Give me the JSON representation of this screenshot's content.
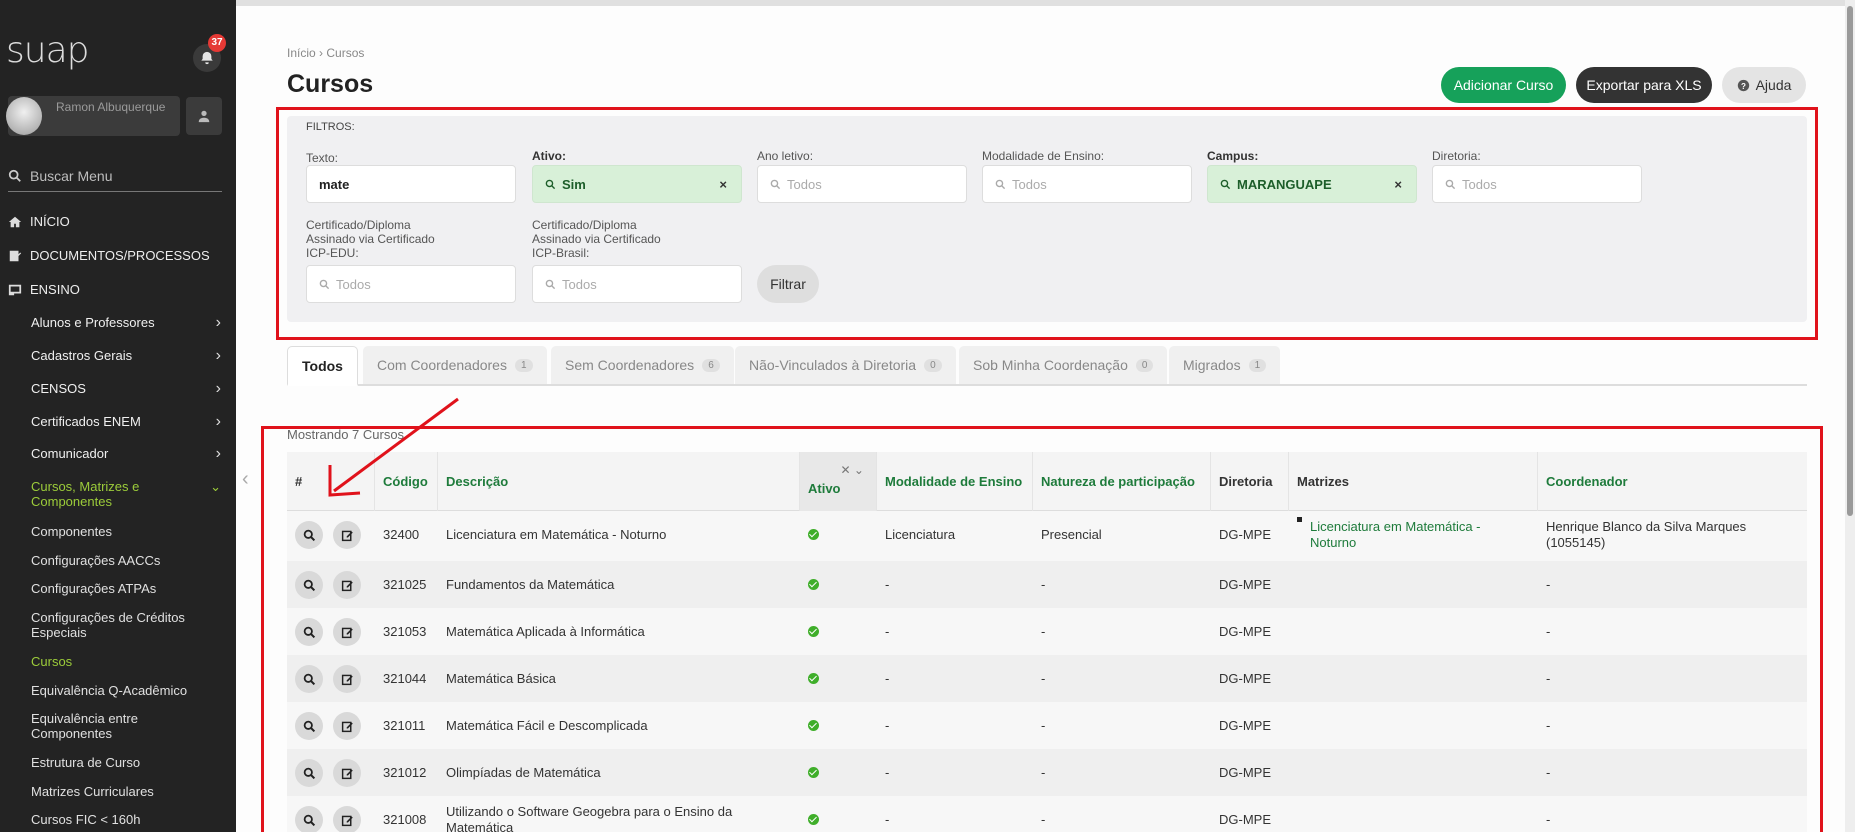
{
  "sidebar": {
    "logo": "suap",
    "notification_count": "37",
    "user_name": "Ramon Albuquerque",
    "search_placeholder": "Buscar Menu",
    "top_items": [
      {
        "label": "INÍCIO",
        "icon": "home-icon"
      },
      {
        "label": "DOCUMENTOS/PROCESSOS",
        "icon": "document-icon"
      },
      {
        "label": "ENSINO",
        "icon": "teaching-icon"
      }
    ],
    "sub_items": [
      {
        "label": "Alunos e Professores"
      },
      {
        "label": "Cadastros Gerais"
      },
      {
        "label": "CENSOS"
      },
      {
        "label": "Certificados ENEM"
      },
      {
        "label": "Comunicador"
      },
      {
        "label": "Cursos, Matrizes e Componentes"
      }
    ],
    "sub_sub_items": [
      {
        "label": "Componentes"
      },
      {
        "label": "Configurações AACCs"
      },
      {
        "label": "Configurações ATPAs"
      },
      {
        "label": "Configurações de Créditos Especiais"
      },
      {
        "label": "Cursos"
      },
      {
        "label": "Equivalência Q-Acadêmico"
      },
      {
        "label": "Equivalência entre Componentes"
      },
      {
        "label": "Estrutura de Curso"
      },
      {
        "label": "Matrizes Curriculares"
      },
      {
        "label": "Cursos FIC < 160h"
      }
    ]
  },
  "header": {
    "breadcrumb_home": "Início",
    "breadcrumb_sep": "›",
    "breadcrumb_current": "Cursos",
    "title": "Cursos",
    "add_button": "Adicionar Curso",
    "export_button": "Exportar para XLS",
    "help_button": "Ajuda"
  },
  "filters": {
    "title": "FILTROS:",
    "texto_label": "Texto:",
    "texto_value": "mate",
    "ativo_label": "Ativo:",
    "ativo_value": "Sim",
    "ano_label": "Ano letivo:",
    "ano_value": "Todos",
    "modalidade_label": "Modalidade de Ensino:",
    "modalidade_value": "Todos",
    "campus_label": "Campus:",
    "campus_value": "MARANGUAPE",
    "diretoria_label": "Diretoria:",
    "diretoria_value": "Todos",
    "icpedu_label": "Certificado/Diploma Assinado via Certificado ICP-EDU:",
    "icpedu_value": "Todos",
    "icpbrasil_label": "Certificado/Diploma Assinado via Certificado ICP-Brasil:",
    "icpbrasil_value": "Todos",
    "filter_button": "Filtrar",
    "clear_symbol": "×"
  },
  "tabs": [
    {
      "label": "Todos",
      "count": ""
    },
    {
      "label": "Com Coordenadores",
      "count": "1"
    },
    {
      "label": "Sem Coordenadores",
      "count": "6"
    },
    {
      "label": "Não-Vinculados à Diretoria",
      "count": "0"
    },
    {
      "label": "Sob Minha Coordenação",
      "count": "0"
    },
    {
      "label": "Migrados",
      "count": "1"
    }
  ],
  "table": {
    "showing_text": "Mostrando 7 Cursos",
    "headers": {
      "hash": "#",
      "codigo": "Código",
      "descricao": "Descrição",
      "ativo": "Ativo",
      "modalidade": "Modalidade de Ensino",
      "natureza": "Natureza de participação",
      "diretoria": "Diretoria",
      "matrizes": "Matrizes",
      "coordenador": "Coordenador"
    },
    "rows": [
      {
        "codigo": "32400",
        "descricao": "Licenciatura em Matemática - Noturno",
        "modalidade": "Licenciatura",
        "natureza": "Presencial",
        "diretoria": "DG-MPE",
        "matriz": "Licenciatura em Matemática - Noturno",
        "coordenador": "Henrique Blanco da Silva Marques (1055145)"
      },
      {
        "codigo": "321025",
        "descricao": "Fundamentos da Matemática",
        "modalidade": "-",
        "natureza": "-",
        "diretoria": "DG-MPE",
        "matriz": "",
        "coordenador": "-"
      },
      {
        "codigo": "321053",
        "descricao": "Matemática Aplicada à Informática",
        "modalidade": "-",
        "natureza": "-",
        "diretoria": "DG-MPE",
        "matriz": "",
        "coordenador": "-"
      },
      {
        "codigo": "321044",
        "descricao": "Matemática Básica",
        "modalidade": "-",
        "natureza": "-",
        "diretoria": "DG-MPE",
        "matriz": "",
        "coordenador": "-"
      },
      {
        "codigo": "321011",
        "descricao": "Matemática Fácil e Descomplicada",
        "modalidade": "-",
        "natureza": "-",
        "diretoria": "DG-MPE",
        "matriz": "",
        "coordenador": "-"
      },
      {
        "codigo": "321012",
        "descricao": "Olimpíadas de Matemática",
        "modalidade": "-",
        "natureza": "-",
        "diretoria": "DG-MPE",
        "matriz": "",
        "coordenador": "-"
      },
      {
        "codigo": "321008",
        "descricao": "Utilizando o Software Geogebra para o Ensino da Matemática",
        "modalidade": "-",
        "natureza": "-",
        "diretoria": "DG-MPE",
        "matriz": "",
        "coordenador": "-"
      }
    ]
  },
  "colors": {
    "sidebar_bg": "#232323",
    "accent_green": "#16a15a",
    "active_green": "#9ccc3a",
    "annotation_red": "#e0121b"
  }
}
